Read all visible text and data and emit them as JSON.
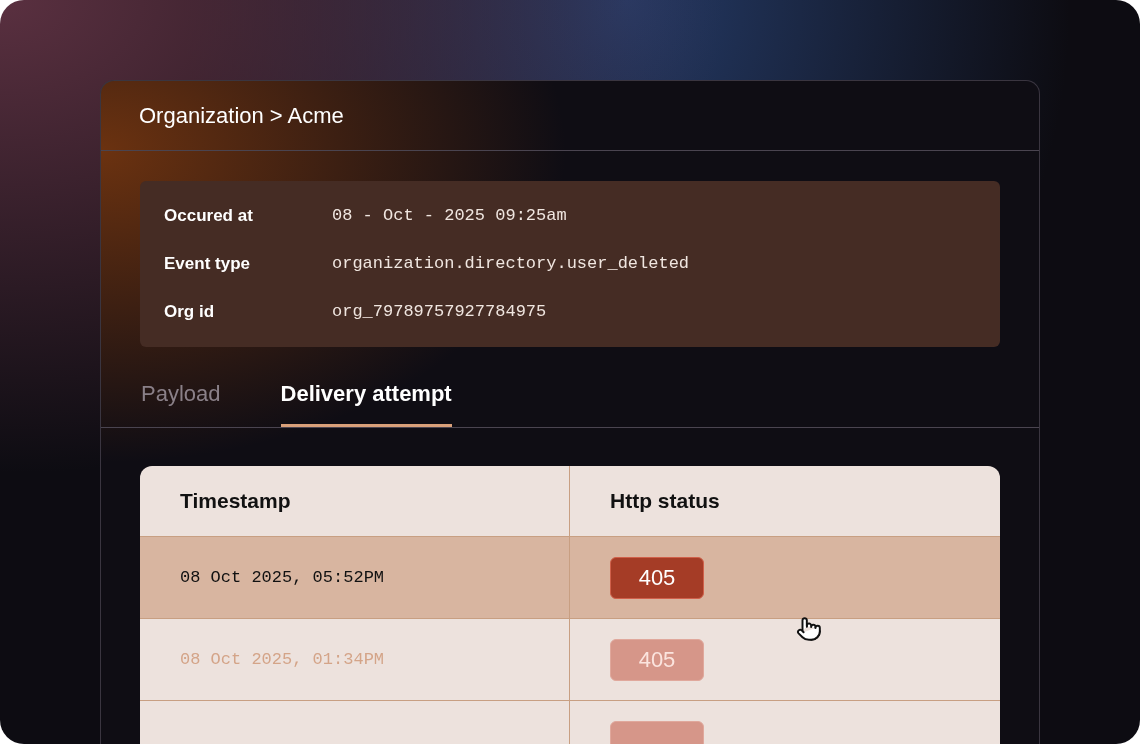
{
  "breadcrumb": "Organization > Acme",
  "details": [
    {
      "label": "Occured at",
      "value": "08 - Oct - 2025 09:25am"
    },
    {
      "label": "Event type",
      "value": "organization.directory.user_deleted"
    },
    {
      "label": "Org id",
      "value": "org_79789757927784975"
    }
  ],
  "tabs": [
    {
      "label": "Payload",
      "selected": false
    },
    {
      "label": "Delivery attempt",
      "selected": true
    }
  ],
  "table": {
    "columns": [
      "Timestamp",
      "Http status"
    ],
    "rows": [
      {
        "timestamp": "08 Oct 2025, 05:52PM",
        "status": "405",
        "selected": true
      },
      {
        "timestamp": "08 Oct 2025, 01:34PM",
        "status": "405",
        "selected": false
      },
      {
        "selected": false
      }
    ]
  }
}
